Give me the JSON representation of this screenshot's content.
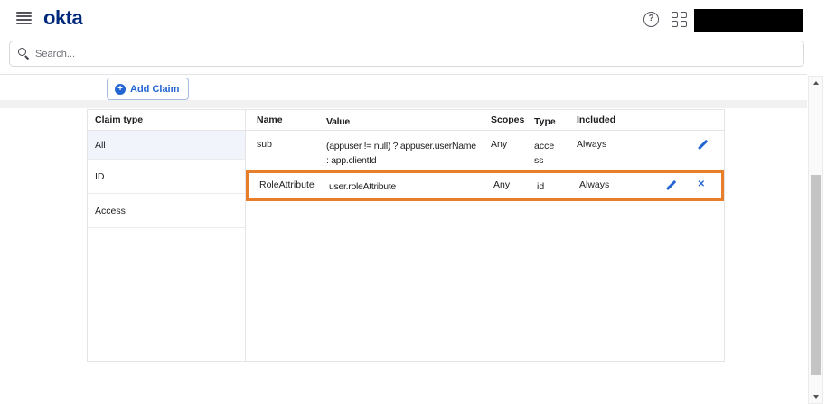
{
  "topnav": {
    "logo_text": "okta",
    "help_icon": "question-mark-in-circle",
    "apps_icon": "2x2-grid",
    "account_area": "redacted-black-box"
  },
  "search": {
    "placeholder": "Search..."
  },
  "toolbar": {
    "add_claim_label": "Add Claim",
    "plus_glyph": "+"
  },
  "claim_types": {
    "header": "Claim type",
    "items": [
      {
        "label": "All",
        "selected": true
      },
      {
        "label": "ID",
        "selected": false
      },
      {
        "label": "Access",
        "selected": false
      }
    ]
  },
  "claims_table": {
    "columns": {
      "name": "Name",
      "value": "Value",
      "scopes": "Scopes",
      "type": "Type",
      "included": "Included"
    },
    "rows": [
      {
        "name": "sub",
        "value": "(appuser != null) ? appuser.userName : app.clientId",
        "scopes": "Any",
        "type": "access",
        "included": "Always",
        "actions": [
          "edit"
        ],
        "highlighted": false
      },
      {
        "name": "RoleAttribute",
        "value": "user.roleAttribute",
        "scopes": "Any",
        "type": "id",
        "included": "Always",
        "actions": [
          "edit",
          "delete"
        ],
        "highlighted": true
      }
    ],
    "delete_glyph": "✕"
  },
  "colors": {
    "accent_blue": "#2264d1",
    "logo_navy": "#00297a",
    "highlight_orange": "#e87d2a",
    "selected_row_bg": "#f1f4fb",
    "border_gray": "#e4e4e7"
  }
}
